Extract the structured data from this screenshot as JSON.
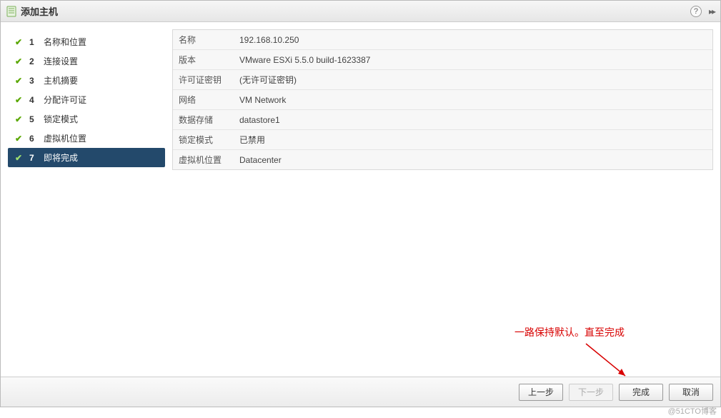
{
  "titlebar": {
    "title": "添加主机",
    "help": "?",
    "collapse": "▸▸"
  },
  "sidebar": {
    "steps": [
      {
        "num": "1",
        "label": "名称和位置"
      },
      {
        "num": "2",
        "label": "连接设置"
      },
      {
        "num": "3",
        "label": "主机摘要"
      },
      {
        "num": "4",
        "label": "分配许可证"
      },
      {
        "num": "5",
        "label": "锁定模式"
      },
      {
        "num": "6",
        "label": "虚拟机位置"
      },
      {
        "num": "7",
        "label": "即将完成"
      }
    ]
  },
  "summary": {
    "rows": [
      {
        "k": "名称",
        "v": "192.168.10.250"
      },
      {
        "k": "版本",
        "v": "VMware ESXi 5.5.0 build-1623387"
      },
      {
        "k": "许可证密钥",
        "v": "(无许可证密钥)"
      },
      {
        "k": "网络",
        "v": "VM Network"
      },
      {
        "k": "数据存储",
        "v": "datastore1"
      },
      {
        "k": "锁定模式",
        "v": "已禁用"
      },
      {
        "k": "虚拟机位置",
        "v": "Datacenter"
      }
    ]
  },
  "footer": {
    "back": "上一步",
    "next": "下一步",
    "finish": "完成",
    "cancel": "取消"
  },
  "annotation": "一路保持默认。直至完成",
  "watermark": "@51CTO博客"
}
